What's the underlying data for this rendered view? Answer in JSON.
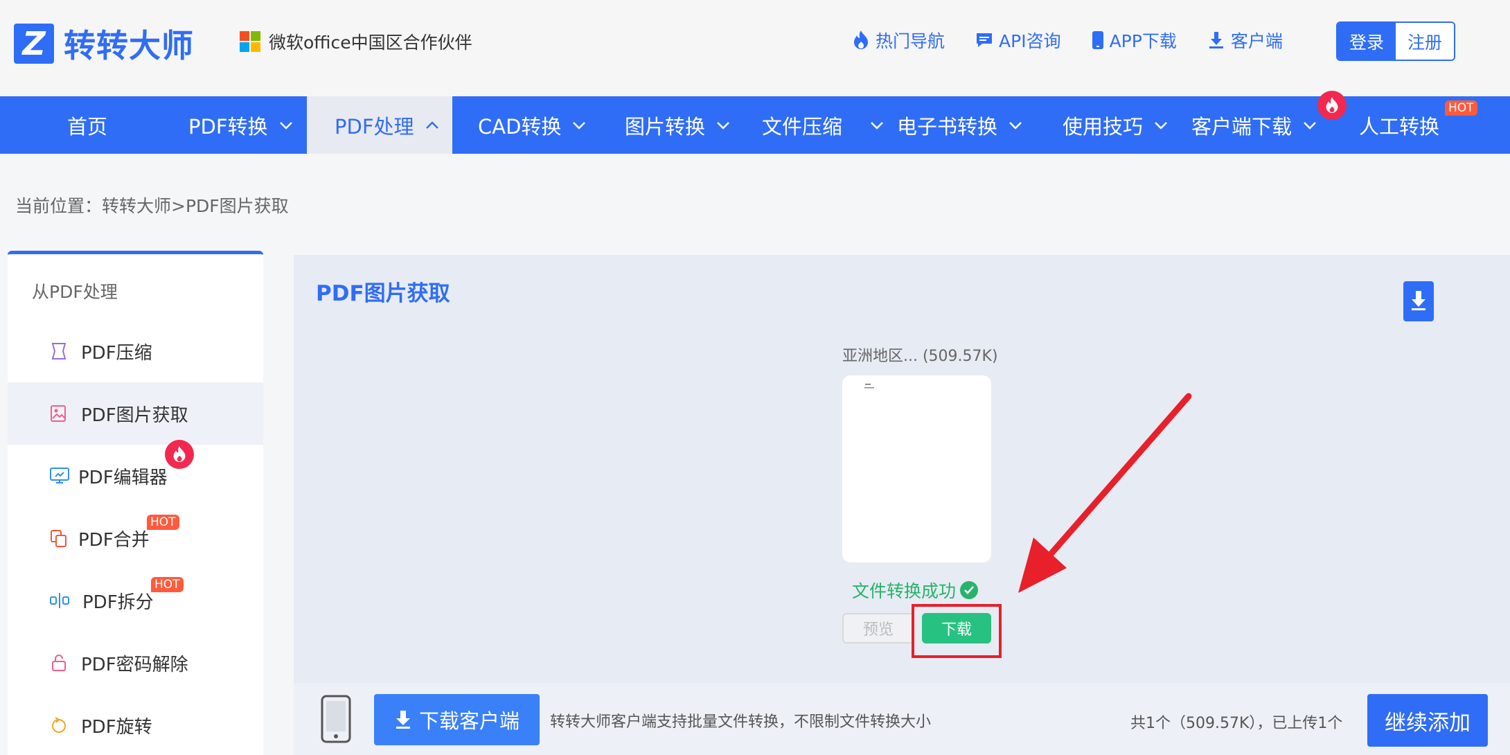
{
  "brand": {
    "name": "转转大师",
    "logo_letter": "Z",
    "accent": "#2f6df6"
  },
  "partner": {
    "text": "微软office中国区合作伙伴",
    "icon": "microsoft-logo"
  },
  "top_links": [
    {
      "label": "热门导航",
      "icon": "flame-icon"
    },
    {
      "label": "API咨询",
      "icon": "chat-icon"
    },
    {
      "label": "APP下载",
      "icon": "phone-icon"
    },
    {
      "label": "客户端",
      "icon": "download-icon"
    }
  ],
  "auth": {
    "login": "登录",
    "register": "注册"
  },
  "nav": {
    "items": [
      {
        "label": "首页",
        "dropdown": false
      },
      {
        "label": "PDF转换",
        "dropdown": true
      },
      {
        "label": "PDF处理",
        "dropdown": true,
        "active": true
      },
      {
        "label": "CAD转换",
        "dropdown": true
      },
      {
        "label": "图片转换",
        "dropdown": true
      },
      {
        "label": "文件压缩",
        "dropdown": true
      },
      {
        "label": "电子书转换",
        "dropdown": true
      },
      {
        "label": "使用技巧",
        "dropdown": true
      },
      {
        "label": "客户端下载",
        "dropdown": true,
        "badge": "flame"
      },
      {
        "label": "人工转换",
        "dropdown": false,
        "badge": "HOT"
      }
    ]
  },
  "breadcrumb": "当前位置：转转大师>PDF图片获取",
  "sidebar": {
    "heading": "从PDF处理",
    "items": [
      {
        "label": "PDF压缩",
        "icon": "compress-icon"
      },
      {
        "label": "PDF图片获取",
        "icon": "image-extract-icon",
        "active": true
      },
      {
        "label": "PDF编辑器",
        "icon": "monitor-edit-icon",
        "badge": "flame"
      },
      {
        "label": "PDF合并",
        "icon": "merge-icon",
        "badge": "HOT"
      },
      {
        "label": "PDF拆分",
        "icon": "split-icon",
        "badge": "HOT"
      },
      {
        "label": "PDF密码解除",
        "icon": "unlock-icon"
      },
      {
        "label": "PDF旋转",
        "icon": "rotate-icon"
      }
    ]
  },
  "main": {
    "title": "PDF图片获取",
    "file_name": "亚洲地区... (509.57K)",
    "status": "文件转换成功",
    "preview_label": "预览",
    "download_label": "下载"
  },
  "bottom": {
    "client_button": "下载客户端",
    "description": "转转大师客户端支持批量文件转换，不限制文件转换大小",
    "summary": "共1个（509.57K），已上传1个",
    "continue_button": "继续添加"
  },
  "colors": {
    "primary": "#2f6df6",
    "success": "#27c281",
    "hot": "#ff5a3c",
    "flame_badge": "#f2284f",
    "highlight": "#e8202a"
  }
}
